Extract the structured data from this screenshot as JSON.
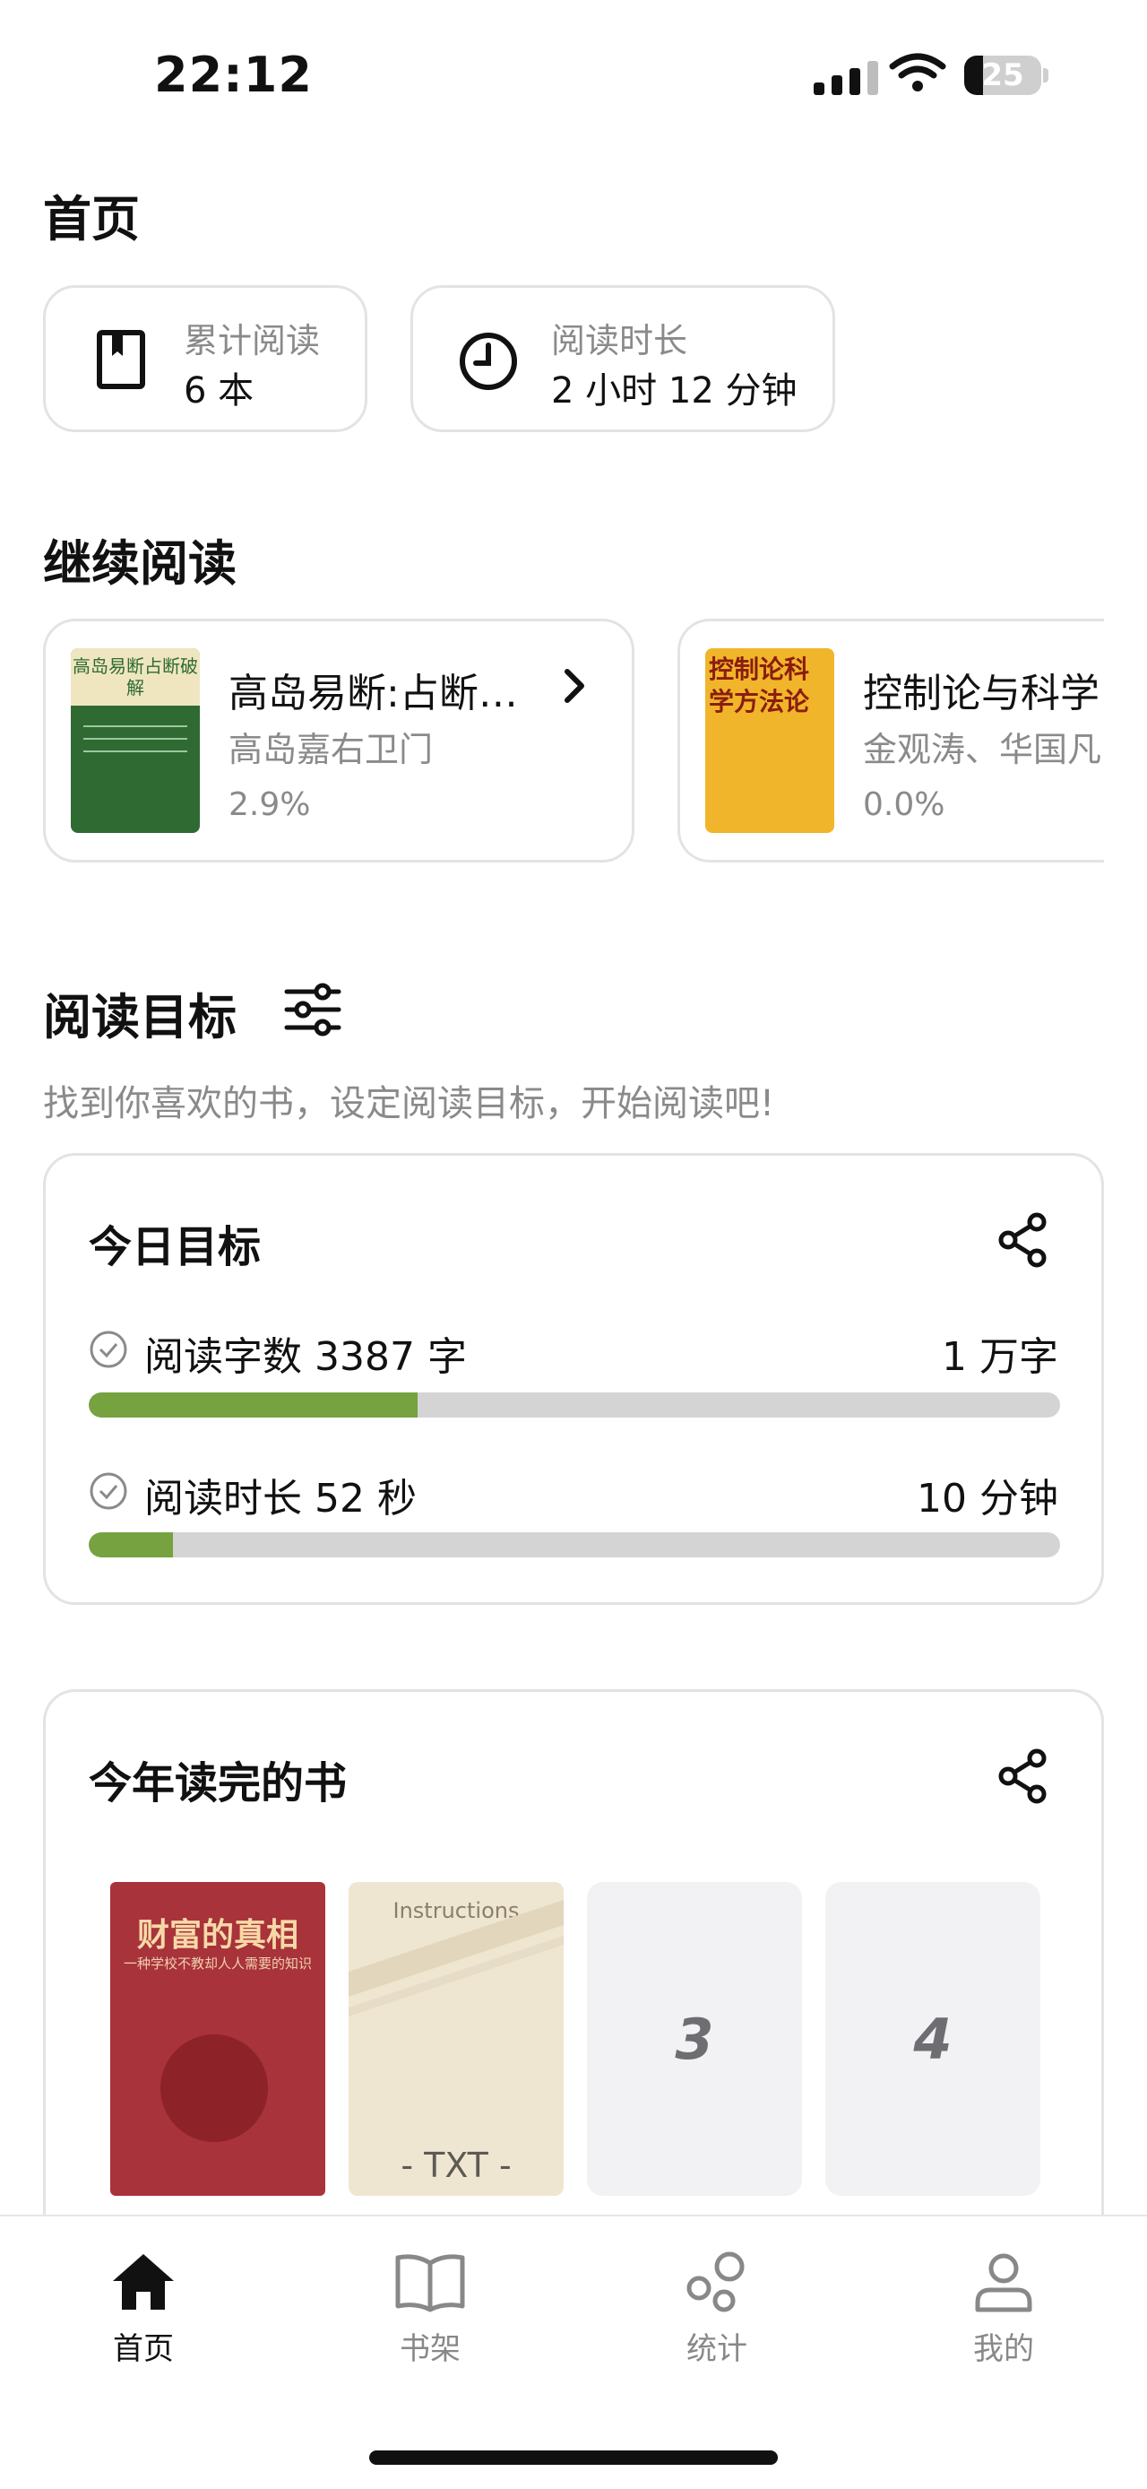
{
  "status_bar": {
    "time": "22:12",
    "battery": "25"
  },
  "page": {
    "title": "首页"
  },
  "stats": [
    {
      "label": "累计阅读",
      "value": "6 本",
      "icon": "bookmark-book-icon"
    },
    {
      "label": "阅读时长",
      "value": "2 小时 12 分钟",
      "icon": "clock-icon"
    }
  ],
  "continue_reading": {
    "heading": "继续阅读",
    "books": [
      {
        "title": "高岛易断:占断…",
        "author": "高岛嘉右卫门",
        "progress": "2.9%",
        "cover_text": "高岛易断占断破解"
      },
      {
        "title": "控制论与科学",
        "author": "金观涛、华国凡",
        "progress": "0.0%",
        "cover_text": "控制论科学方法论"
      }
    ]
  },
  "goals": {
    "heading": "阅读目标",
    "hint": "找到你喜欢的书，设定阅读目标，开始阅读吧!",
    "today": {
      "title": "今日目标",
      "items": [
        {
          "label": "阅读字数 3387 字",
          "target": "1 万字",
          "progress": 0.339
        },
        {
          "label": "阅读时长 52 秒",
          "target": "10 分钟",
          "progress": 0.087
        }
      ]
    }
  },
  "finished": {
    "title": "今年读完的书",
    "books": [
      {
        "cover_title": "财富的真相",
        "cover_sub": "一种学校不教却人人需要的知识"
      },
      {
        "cover_title": "Instructions",
        "cover_sub": "- TXT -"
      }
    ],
    "placeholders": [
      "3",
      "4"
    ]
  },
  "tabbar": [
    {
      "label": "首页",
      "icon": "home-icon",
      "active": true
    },
    {
      "label": "书架",
      "icon": "open-book-icon",
      "active": false
    },
    {
      "label": "统计",
      "icon": "stats-bubbles-icon",
      "active": false
    },
    {
      "label": "我的",
      "icon": "user-icon",
      "active": false
    }
  ],
  "colors": {
    "accent_green": "#76a23f",
    "track_gray": "#d4d4d4"
  }
}
